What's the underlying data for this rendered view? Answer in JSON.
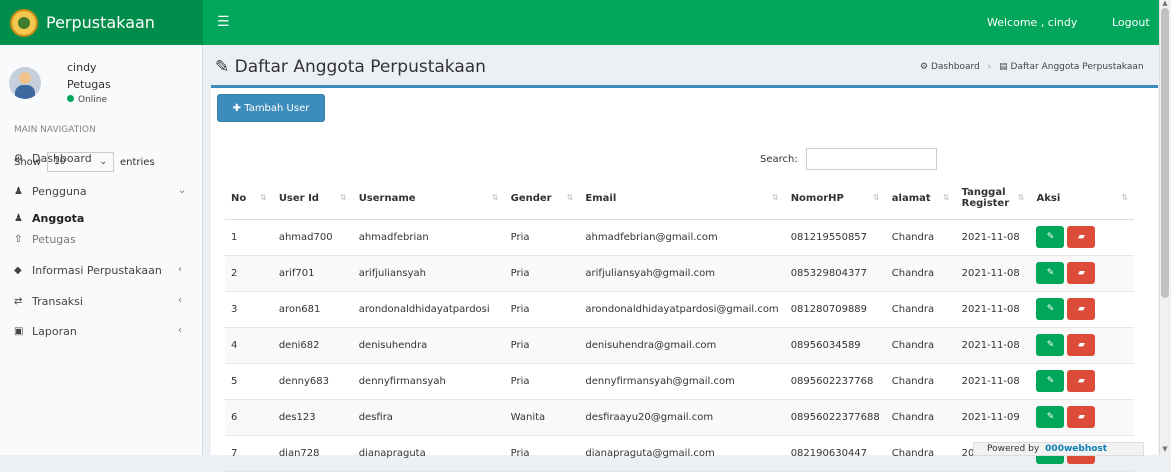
{
  "header": {
    "app_title": "Perpustakaan",
    "welcome": "Welcome , cindy",
    "logout": "Logout"
  },
  "user": {
    "name": "cindy",
    "role": "Petugas",
    "status": "Online"
  },
  "navigation": {
    "header": "MAIN NAVIGATION",
    "items": [
      {
        "label": "Dashboard"
      },
      {
        "label": "Pengguna"
      },
      {
        "label": "Anggota"
      },
      {
        "label": "Petugas"
      },
      {
        "label": "Informasi Perpustakaan"
      },
      {
        "label": "Transaksi"
      },
      {
        "label": "Laporan"
      }
    ]
  },
  "page": {
    "title": "Daftar Anggota Perpustakaan",
    "breadcrumb": [
      "Dashboard",
      "Daftar Anggota Perpustakaan"
    ],
    "add_button": "Tambah User",
    "show_label": "Show",
    "entries_value": "10",
    "entries_label": "entries",
    "search_label": "Search:"
  },
  "table": {
    "headers": [
      "No",
      "User Id",
      "Username",
      "Gender",
      "Email",
      "NomorHP",
      "alamat",
      "Tanggal Register",
      "Aksi"
    ],
    "rows": [
      [
        "1",
        "ahmad700",
        "ahmadfebrian",
        "Pria",
        "ahmadfebrian@gmail.com",
        "081219550857",
        "Chandra",
        "2021-11-08"
      ],
      [
        "2",
        "arif701",
        "arifjuliansyah",
        "Pria",
        "arifjuliansyah@gmail.com",
        "085329804377",
        "Chandra",
        "2021-11-08"
      ],
      [
        "3",
        "aron681",
        "arondonaldhidayatpardosi",
        "Pria",
        "arondonaldhidayatpardosi@gmail.com",
        "081280709889",
        "Chandra",
        "2021-11-08"
      ],
      [
        "4",
        "deni682",
        "denisuhendra",
        "Pria",
        "denisuhendra@gmail.com",
        "08956034589",
        "Chandra",
        "2021-11-08"
      ],
      [
        "5",
        "denny683",
        "dennyfirmansyah",
        "Pria",
        "dennyfirmansyah@gmail.com",
        "0895602237768",
        "Chandra",
        "2021-11-08"
      ],
      [
        "6",
        "des123",
        "desfira",
        "Wanita",
        "desfiraayu20@gmail.com",
        "08956022377688",
        "Chandra",
        "2021-11-09"
      ],
      [
        "7",
        "dian728",
        "dianapraguta",
        "Pria",
        "dianapraguta@gmail.com",
        "082190630447",
        "Chandra",
        "2021-11-08"
      ]
    ]
  },
  "footer": {
    "powered_by": "Powered by",
    "host": "000webhost"
  }
}
